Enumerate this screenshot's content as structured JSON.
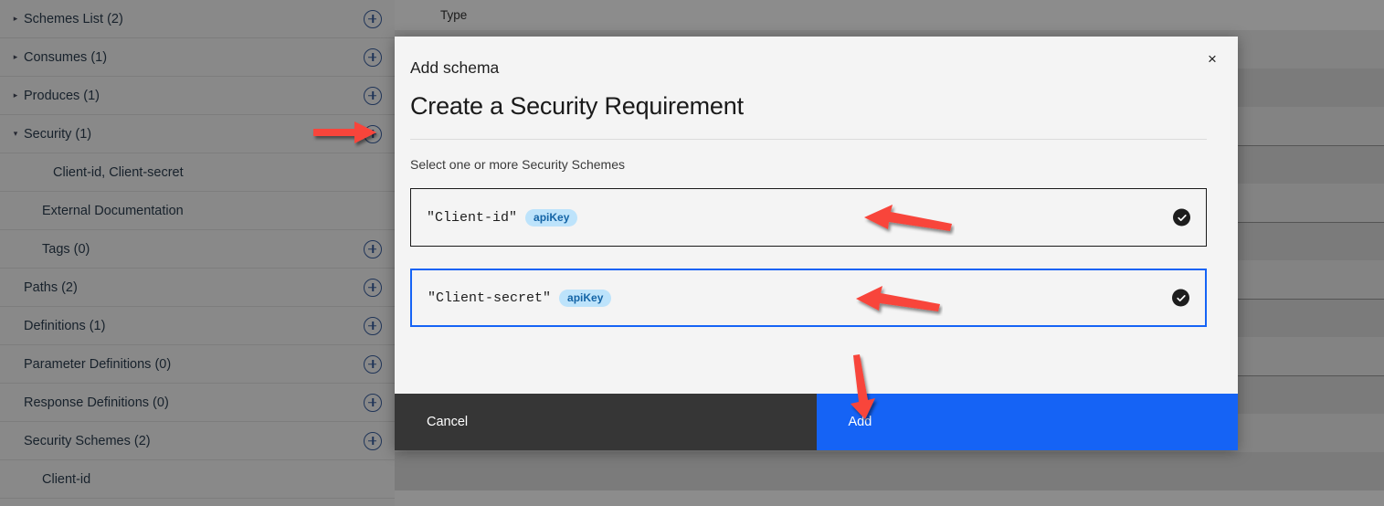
{
  "sidebar": {
    "items": [
      {
        "label": "Schemes List (2)",
        "caret": "▸",
        "indent": 0,
        "has_plus": true
      },
      {
        "label": "Consumes (1)",
        "caret": "▸",
        "indent": 0,
        "has_plus": true
      },
      {
        "label": "Produces (1)",
        "caret": "▸",
        "indent": 0,
        "has_plus": true
      },
      {
        "label": "Security (1)",
        "caret": "▾",
        "indent": 0,
        "has_plus": true
      },
      {
        "label": "Client-id, Client-secret",
        "caret": "",
        "indent": 2,
        "has_plus": false
      },
      {
        "label": "External Documentation",
        "caret": "",
        "indent": 1,
        "has_plus": false
      },
      {
        "label": "Tags (0)",
        "caret": "",
        "indent": 1,
        "has_plus": true
      },
      {
        "label": "Paths (2)",
        "caret": "",
        "indent": 0,
        "has_plus": true
      },
      {
        "label": "Definitions (1)",
        "caret": "",
        "indent": 0,
        "has_plus": true
      },
      {
        "label": "Parameter Definitions (0)",
        "caret": "",
        "indent": 0,
        "has_plus": true
      },
      {
        "label": "Response Definitions (0)",
        "caret": "",
        "indent": 0,
        "has_plus": true
      },
      {
        "label": "Security Schemes (2)",
        "caret": "",
        "indent": 0,
        "has_plus": true
      },
      {
        "label": "Client-id",
        "caret": "",
        "indent": 1,
        "has_plus": false
      }
    ]
  },
  "background": {
    "column_header": "Type"
  },
  "modal": {
    "kicker": "Add schema",
    "title": "Create a Security Requirement",
    "subtitle": "Select one or more Security Schemes",
    "close_label": "×",
    "schemes": [
      {
        "name": "\"Client-id\"",
        "type_badge": "apiKey",
        "selected": true,
        "focused": false
      },
      {
        "name": "\"Client-secret\"",
        "type_badge": "apiKey",
        "selected": true,
        "focused": true
      }
    ],
    "footer": {
      "cancel_label": "Cancel",
      "add_label": "Add"
    }
  },
  "colors": {
    "accent_blue": "#1563f5",
    "badge_bg": "#bde3fb",
    "badge_text": "#1464a6",
    "footer_dark": "#363636",
    "annotation_red": "#f8453a",
    "plus_blue": "#3a5fa0"
  }
}
